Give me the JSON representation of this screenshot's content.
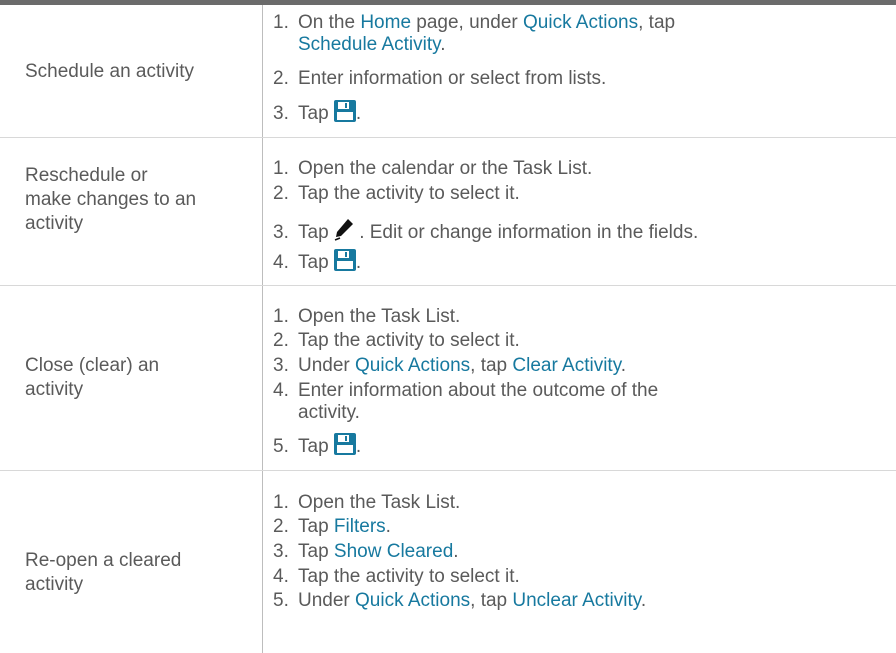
{
  "rows": [
    {
      "label": "Schedule an activity",
      "steps": [
        {
          "num": "1.",
          "pre": "On the ",
          "link1": "Home",
          "mid": " page, under ",
          "link2": "Quick Actions",
          "post": ", tap",
          "line2": "Schedule Activity",
          "line2_end": "."
        },
        {
          "num": "2.",
          "text": "Enter information or select from lists."
        },
        {
          "num": "3.",
          "pre": "Tap ",
          "icon": "save-icon",
          "post": "."
        }
      ]
    },
    {
      "label_lines": [
        "Reschedule or",
        "make changes to an",
        "activity"
      ],
      "steps": [
        {
          "num": "1.",
          "text": "Open the calendar or the Task List."
        },
        {
          "num": "2.",
          "text": "Tap the activity to select it."
        },
        {
          "num": "3.",
          "pre": "Tap ",
          "icon": "edit-pencil-icon",
          "post": " . Edit or change information in the fields."
        },
        {
          "num": "4.",
          "pre": "Tap ",
          "icon": "save-icon",
          "post": "."
        }
      ]
    },
    {
      "label_lines": [
        "Close (clear) an",
        "activity"
      ],
      "steps": [
        {
          "num": "1.",
          "text": "Open the Task List."
        },
        {
          "num": "2.",
          "text": "Tap the activity to select it."
        },
        {
          "num": "3.",
          "pre": "Under ",
          "link1": "Quick Actions",
          "mid": ", tap ",
          "link2": "Clear Activity",
          "post": "."
        },
        {
          "num": "4.",
          "text": "Enter information about the outcome of the",
          "line2": "activity."
        },
        {
          "num": "5.",
          "pre": "Tap ",
          "icon": "save-icon",
          "post": "."
        }
      ]
    },
    {
      "label_lines": [
        "Re-open a cleared",
        "activity"
      ],
      "steps": [
        {
          "num": "1.",
          "text": "Open the Task List."
        },
        {
          "num": "2.",
          "pre": "Tap ",
          "link1": "Filters",
          "post": "."
        },
        {
          "num": "3.",
          "pre": "Tap ",
          "link1": "Show Cleared",
          "post": "."
        },
        {
          "num": "4.",
          "text": "Tap the activity to select it."
        },
        {
          "num": "5.",
          "pre": "Under ",
          "link1": "Quick Actions",
          "mid": ", tap ",
          "link2": "Unclear Activity",
          "post": "."
        }
      ]
    }
  ],
  "colors": {
    "link": "#17799f",
    "text": "#5a5a5a",
    "save_icon": "#17799f"
  }
}
